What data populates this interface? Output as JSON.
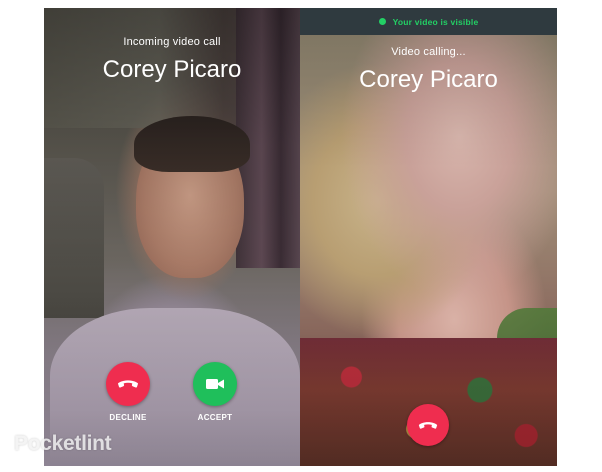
{
  "incoming_screen": {
    "status_text": "Incoming video call",
    "caller_name": "Corey Picaro",
    "decline_label": "DECLINE",
    "accept_label": "ACCEPT",
    "decline_icon": "phone-hangup-icon",
    "accept_icon": "video-camera-icon"
  },
  "outgoing_screen": {
    "banner_text": "Your video is visible",
    "status_text": "Video calling...",
    "caller_name": "Corey Picaro",
    "end_call_icon": "phone-hangup-icon"
  },
  "watermark": {
    "text": "Pocketlint"
  },
  "colors": {
    "decline_red": "#ef2d4f",
    "accept_green": "#1fbf5b",
    "visible_green": "#23d065",
    "banner_bg": "#2f3a3f"
  }
}
